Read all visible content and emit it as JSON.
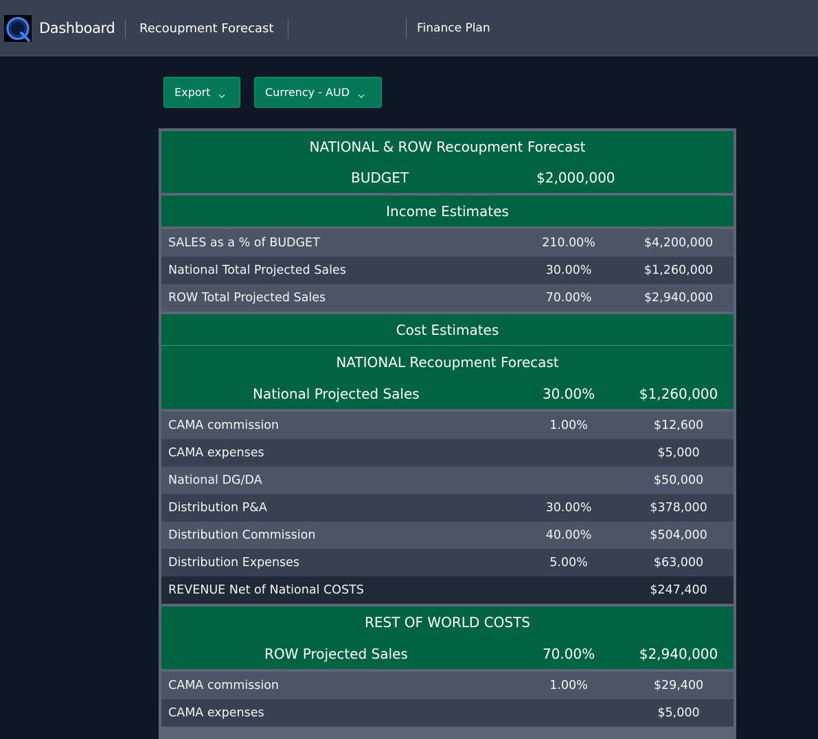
{
  "nav": {
    "dashboard": "Dashboard",
    "recoupment": "Recoupment Forecast",
    "finance_plan": "Finance Plan"
  },
  "toolbar": {
    "export_label": "Export",
    "currency_label": "Currency - AUD"
  },
  "report": {
    "title": "NATIONAL & ROW Recoupment Forecast",
    "budget_label": "BUDGET",
    "budget_value": "$2,000,000",
    "income_heading": "Income Estimates",
    "income_rows": [
      {
        "label": "SALES as a % of BUDGET",
        "pct": "210.00%",
        "amount": "$4,200,000"
      },
      {
        "label": "National Total Projected Sales",
        "pct": "30.00%",
        "amount": "$1,260,000"
      },
      {
        "label": "ROW Total Projected Sales",
        "pct": "70.00%",
        "amount": "$2,940,000"
      }
    ],
    "cost_heading": "Cost Estimates",
    "national": {
      "heading": "NATIONAL Recoupment Forecast",
      "sales_label": "National Projected Sales",
      "sales_pct": "30.00%",
      "sales_amount": "$1,260,000",
      "rows": [
        {
          "label": "CAMA commission",
          "pct": "1.00%",
          "amount": "$12,600"
        },
        {
          "label": "CAMA expenses",
          "pct": "",
          "amount": "$5,000"
        },
        {
          "label": "National DG/DA",
          "pct": "",
          "amount": "$50,000"
        },
        {
          "label": "Distribution P&A",
          "pct": "30.00%",
          "amount": "$378,000"
        },
        {
          "label": "Distribution Commission",
          "pct": "40.00%",
          "amount": "$504,000"
        },
        {
          "label": "Distribution Expenses",
          "pct": "5.00%",
          "amount": "$63,000"
        },
        {
          "label": "REVENUE Net of National COSTS",
          "pct": "",
          "amount": "$247,400"
        }
      ]
    },
    "row_world": {
      "heading": "REST OF WORLD COSTS",
      "sales_label": "ROW Projected Sales",
      "sales_pct": "70.00%",
      "sales_amount": "$2,940,000",
      "rows": [
        {
          "label": "CAMA commission",
          "pct": "1.00%",
          "amount": "$29,400"
        },
        {
          "label": "CAMA expenses",
          "pct": "",
          "amount": "$5,000"
        }
      ]
    }
  },
  "colors": {
    "accent_green": "#006443",
    "button_green": "#047857",
    "topbar": "#374151",
    "background": "#0f1726"
  },
  "icons": {
    "logo": "q-logo-icon",
    "dropdown": "chevron-down-icon"
  }
}
